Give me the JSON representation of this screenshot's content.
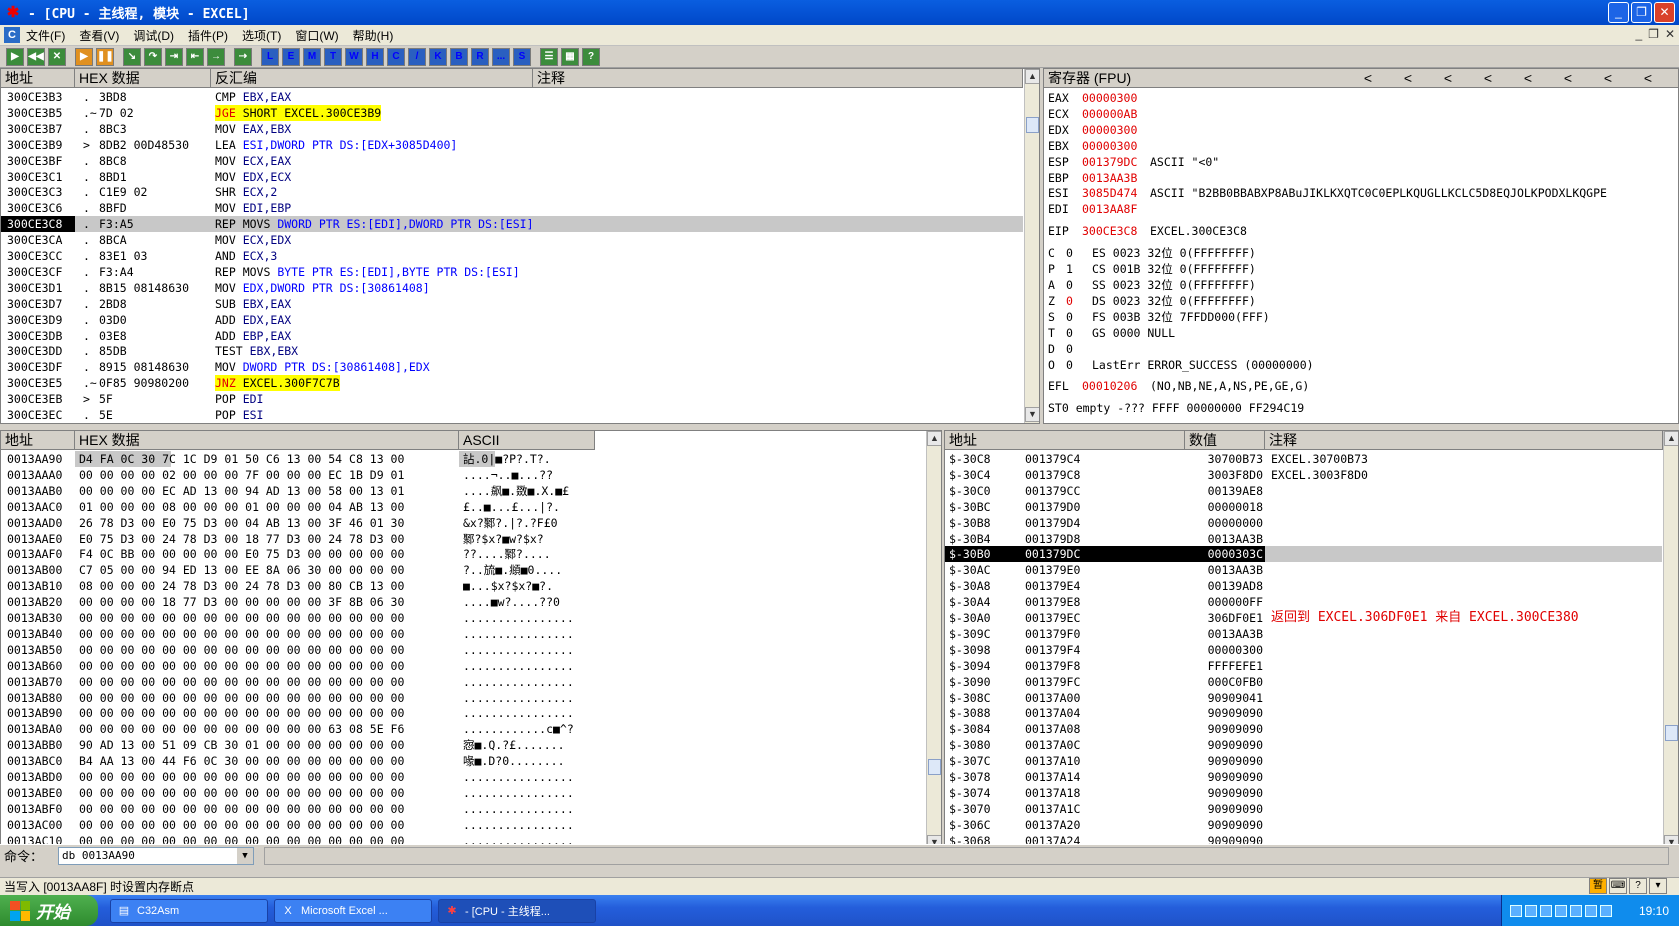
{
  "window": {
    "title": "- [CPU - 主线程, 模块 - EXCEL]",
    "icon": "ollydbg-bug-icon"
  },
  "menu": [
    "文件(F)",
    "查看(V)",
    "调试(D)",
    "插件(P)",
    "选项(T)",
    "窗口(W)",
    "帮助(H)"
  ],
  "mdi_buttons": [
    "_",
    "❐",
    "✕"
  ],
  "toolbar": {
    "nav": [
      "▶",
      "◀◀",
      "✕",
      "▶",
      "❚❚",
      "↘",
      "↷",
      "⇥",
      "⇤",
      "→",
      "⇢"
    ],
    "windows": [
      "L",
      "E",
      "M",
      "T",
      "W",
      "H",
      "C",
      "/",
      "K",
      "B",
      "R",
      "...",
      "S"
    ],
    "extra": [
      "☰",
      "▦",
      "?"
    ]
  },
  "disasm": {
    "headers": [
      "地址",
      "HEX 数据",
      "反汇编",
      "注释"
    ],
    "rows": [
      {
        "addr": "300CE3B3",
        "arrow": ".",
        "hex": "3BD8",
        "mnem": "CMP",
        "ops": " EBX,EAX"
      },
      {
        "addr": "300CE3B5",
        "arrow": ".~",
        "hex": "7D 02",
        "mnem": "JGE",
        "ops": " SHORT EXCEL.300CE3B9",
        "jmp": true
      },
      {
        "addr": "300CE3B7",
        "arrow": ".",
        "hex": "8BC3",
        "mnem": "MOV",
        "ops": " EAX,EBX"
      },
      {
        "addr": "300CE3B9",
        "arrow": ">",
        "hex": "8DB2 00D48530",
        "mnem": "LEA",
        "ops": " ESI,DWORD PTR DS:[EDX+3085D400]"
      },
      {
        "addr": "300CE3BF",
        "arrow": ".",
        "hex": "8BC8",
        "mnem": "MOV",
        "ops": " ECX,EAX"
      },
      {
        "addr": "300CE3C1",
        "arrow": ".",
        "hex": "8BD1",
        "mnem": "MOV",
        "ops": " EDX,ECX"
      },
      {
        "addr": "300CE3C3",
        "arrow": ".",
        "hex": "C1E9 02",
        "mnem": "SHR",
        "ops": " ECX,2"
      },
      {
        "addr": "300CE3C6",
        "arrow": ".",
        "hex": "8BFD",
        "mnem": "MOV",
        "ops": " EDI,EBP"
      },
      {
        "addr": "300CE3C8",
        "arrow": ".",
        "hex": "F3:A5",
        "mnem": "REP MOVS",
        "ops": " DWORD PTR ES:[EDI],DWORD PTR DS:[ESI]",
        "sel": true
      },
      {
        "addr": "300CE3CA",
        "arrow": ".",
        "hex": "8BCA",
        "mnem": "MOV",
        "ops": " ECX,EDX"
      },
      {
        "addr": "300CE3CC",
        "arrow": ".",
        "hex": "83E1 03",
        "mnem": "AND",
        "ops": " ECX,3"
      },
      {
        "addr": "300CE3CF",
        "arrow": ".",
        "hex": "F3:A4",
        "mnem": "REP MOVS",
        "ops": " BYTE PTR ES:[EDI],BYTE PTR DS:[ESI]"
      },
      {
        "addr": "300CE3D1",
        "arrow": ".",
        "hex": "8B15 08148630",
        "mnem": "MOV",
        "ops": " EDX,DWORD PTR DS:[30861408]"
      },
      {
        "addr": "300CE3D7",
        "arrow": ".",
        "hex": "2BD8",
        "mnem": "SUB",
        "ops": " EBX,EAX"
      },
      {
        "addr": "300CE3D9",
        "arrow": ".",
        "hex": "03D0",
        "mnem": "ADD",
        "ops": " EDX,EAX"
      },
      {
        "addr": "300CE3DB",
        "arrow": ".",
        "hex": "03E8",
        "mnem": "ADD",
        "ops": " EBP,EAX"
      },
      {
        "addr": "300CE3DD",
        "arrow": ".",
        "hex": "85DB",
        "mnem": "TEST",
        "ops": " EBX,EBX"
      },
      {
        "addr": "300CE3DF",
        "arrow": ".",
        "hex": "8915 08148630",
        "mnem": "MOV",
        "ops": " DWORD PTR DS:[30861408],EDX"
      },
      {
        "addr": "300CE3E5",
        "arrow": ".~",
        "hex": "0F85 90980200",
        "mnem": "JNZ",
        "ops": " EXCEL.300F7C7B",
        "jmp": true
      },
      {
        "addr": "300CE3EB",
        "arrow": ">",
        "hex": "5F",
        "mnem": "POP",
        "ops": " EDI"
      },
      {
        "addr": "300CE3EC",
        "arrow": ".",
        "hex": "5E",
        "mnem": "POP",
        "ops": " ESI"
      }
    ]
  },
  "registers": {
    "header": "寄存器 (FPU)",
    "arrows": [
      "<",
      "<",
      "<",
      "<",
      "<",
      "<",
      "<",
      "<"
    ],
    "gp": [
      {
        "name": "EAX",
        "value": "00000300",
        "comment": ""
      },
      {
        "name": "ECX",
        "value": "000000AB",
        "comment": ""
      },
      {
        "name": "EDX",
        "value": "00000300",
        "comment": ""
      },
      {
        "name": "EBX",
        "value": "00000300",
        "comment": ""
      },
      {
        "name": "ESP",
        "value": "001379DC",
        "comment": "ASCII \"<0\""
      },
      {
        "name": "EBP",
        "value": "0013AA3B",
        "comment": ""
      },
      {
        "name": "ESI",
        "value": "3085D474",
        "comment": "ASCII \"B2BB0BBABXP8ABuJIKLKXQTC0C0EPLKQUGLLKCLC5D8EQJOLKPODXLKQGPE"
      },
      {
        "name": "EDI",
        "value": "0013AA8F",
        "comment": ""
      }
    ],
    "eip": {
      "name": "EIP",
      "value": "300CE3C8",
      "comment": "EXCEL.300CE3C8"
    },
    "flags": [
      {
        "f": "C",
        "v": "0",
        "seg": "ES 0023 32位 0(FFFFFFFF)",
        "red": false
      },
      {
        "f": "P",
        "v": "1",
        "seg": "CS 001B 32位 0(FFFFFFFF)",
        "red": false
      },
      {
        "f": "A",
        "v": "0",
        "seg": "SS 0023 32位 0(FFFFFFFF)",
        "red": false
      },
      {
        "f": "Z",
        "v": "0",
        "seg": "DS 0023 32位 0(FFFFFFFF)",
        "red": true
      },
      {
        "f": "S",
        "v": "0",
        "seg": "FS 003B 32位 7FFDD000(FFF)",
        "red": false
      },
      {
        "f": "T",
        "v": "0",
        "seg": "GS 0000 NULL",
        "red": false
      },
      {
        "f": "D",
        "v": "0",
        "seg": "",
        "red": false
      },
      {
        "f": "O",
        "v": "0",
        "seg": "LastErr ERROR_SUCCESS (00000000)",
        "red": false
      }
    ],
    "efl": {
      "name": "EFL",
      "value": "00010206",
      "comment": "(NO,NB,NE,A,NS,PE,GE,G)"
    },
    "st0": "ST0 empty -??? FFFF 00000000 FF294C19"
  },
  "dump": {
    "headers": [
      "地址",
      "HEX 数据",
      "ASCII"
    ],
    "rows": [
      {
        "addr": "0013AA90",
        "hex": "D4 FA 0C 30 7C 1C D9 01 50 C6 13 00 54 C8 13 00",
        "ascii": "詀.0|■?P?.T?.",
        "sel": true
      },
      {
        "addr": "0013AAA0",
        "hex": "00 00 00 00 02 00 00 00 7F 00 00 00 EC 1B D9 01",
        "ascii": "....¬..■...??"
      },
      {
        "addr": "0013AAB0",
        "hex": "00 00 00 00 EC AD 13 00 94 AD 13 00 58 00 13 01",
        "ascii": "....飙■.敪■.X.■£"
      },
      {
        "addr": "0013AAC0",
        "hex": "01 00 00 00 08 00 00 00 01 00 00 00 04 AB 13 00",
        "ascii": "£..■...£...|?."
      },
      {
        "addr": "0013AAD0",
        "hex": "26 78 D3 00 E0 75 D3 00 04 AB 13 00 3F 46 01 30",
        "ascii": "&x?鄹?.|?.?F£0"
      },
      {
        "addr": "0013AAE0",
        "hex": "E0 75 D3 00 24 78 D3 00 18 77 D3 00 24 78 D3 00",
        "ascii": "鄹?$x?■w?$x?"
      },
      {
        "addr": "0013AAF0",
        "hex": "F4 0C BB 00 00 00 00 00 E0 75 D3 00 00 00 00 00",
        "ascii": "??....鄹?...."
      },
      {
        "addr": "0013AB00",
        "hex": "C7 05 00 00 94 ED 13 00 EE 8A 06 30 00 00 00 00",
        "ascii": "?..旈■.頫■0...."
      },
      {
        "addr": "0013AB10",
        "hex": "08 00 00 00 24 78 D3 00 24 78 D3 00 80 CB 13 00",
        "ascii": "■...$x?$x?■?."
      },
      {
        "addr": "0013AB20",
        "hex": "00 00 00 00 18 77 D3 00 00 00 00 00 3F 8B 06 30",
        "ascii": "....■w?....??0"
      },
      {
        "addr": "0013AB30",
        "hex": "00 00 00 00 00 00 00 00 00 00 00 00 00 00 00 00",
        "ascii": "................"
      },
      {
        "addr": "0013AB40",
        "hex": "00 00 00 00 00 00 00 00 00 00 00 00 00 00 00 00",
        "ascii": "................"
      },
      {
        "addr": "0013AB50",
        "hex": "00 00 00 00 00 00 00 00 00 00 00 00 00 00 00 00",
        "ascii": "................"
      },
      {
        "addr": "0013AB60",
        "hex": "00 00 00 00 00 00 00 00 00 00 00 00 00 00 00 00",
        "ascii": "................"
      },
      {
        "addr": "0013AB70",
        "hex": "00 00 00 00 00 00 00 00 00 00 00 00 00 00 00 00",
        "ascii": "................"
      },
      {
        "addr": "0013AB80",
        "hex": "00 00 00 00 00 00 00 00 00 00 00 00 00 00 00 00",
        "ascii": "................"
      },
      {
        "addr": "0013AB90",
        "hex": "00 00 00 00 00 00 00 00 00 00 00 00 00 00 00 00",
        "ascii": "................"
      },
      {
        "addr": "0013ABA0",
        "hex": "00 00 00 00 00 00 00 00 00 00 00 00 63 08 5E F6",
        "ascii": "............c■^?"
      },
      {
        "addr": "0013ABB0",
        "hex": "90 AD 13 00 51 09 CB 30 01 00 00 00 00 00 00 00",
        "ascii": "惌■.Q.?£......."
      },
      {
        "addr": "0013ABC0",
        "hex": "B4 AA 13 00 44 F6 0C 30 00 00 00 00 00 00 00 00",
        "ascii": "喙■.D?0........"
      },
      {
        "addr": "0013ABD0",
        "hex": "00 00 00 00 00 00 00 00 00 00 00 00 00 00 00 00",
        "ascii": "................"
      },
      {
        "addr": "0013ABE0",
        "hex": "00 00 00 00 00 00 00 00 00 00 00 00 00 00 00 00",
        "ascii": "................"
      },
      {
        "addr": "0013ABF0",
        "hex": "00 00 00 00 00 00 00 00 00 00 00 00 00 00 00 00",
        "ascii": "................"
      },
      {
        "addr": "0013AC00",
        "hex": "00 00 00 00 00 00 00 00 00 00 00 00 00 00 00 00",
        "ascii": "................"
      },
      {
        "addr": "0013AC10",
        "hex": "00 00 00 00 00 00 00 00 00 00 00 00 00 00 00 00",
        "ascii": "................"
      }
    ]
  },
  "stack": {
    "headers": [
      "地址",
      "数值",
      "注释"
    ],
    "rows": [
      {
        "off": "$-30C8",
        "addr": "001379C4",
        "val": "30700B73",
        "comment": "EXCEL.30700B73"
      },
      {
        "off": "$-30C4",
        "addr": "001379C8",
        "val": "3003F8D0",
        "comment": "EXCEL.3003F8D0"
      },
      {
        "off": "$-30C0",
        "addr": "001379CC",
        "val": "00139AE8",
        "comment": ""
      },
      {
        "off": "$-30BC",
        "addr": "001379D0",
        "val": "00000018",
        "comment": ""
      },
      {
        "off": "$-30B8",
        "addr": "001379D4",
        "val": "00000000",
        "comment": ""
      },
      {
        "off": "$-30B4",
        "addr": "001379D8",
        "val": "0013AA3B",
        "comment": ""
      },
      {
        "off": "$-30B0",
        "addr": "001379DC",
        "val": "0000303C",
        "comment": "",
        "sel": true
      },
      {
        "off": "$-30AC",
        "addr": "001379E0",
        "val": "0013AA3B",
        "comment": ""
      },
      {
        "off": "$-30A8",
        "addr": "001379E4",
        "val": "00139AD8",
        "comment": ""
      },
      {
        "off": "$-30A4",
        "addr": "001379E8",
        "val": "000000FF",
        "comment": ""
      },
      {
        "off": "$-30A0",
        "addr": "001379EC",
        "val": "306DF0E1",
        "comment": "返回到 EXCEL.306DF0E1 来自 EXCEL.300CE380",
        "red": true
      },
      {
        "off": "$-309C",
        "addr": "001379F0",
        "val": "0013AA3B",
        "comment": ""
      },
      {
        "off": "$-3098",
        "addr": "001379F4",
        "val": "00000300",
        "comment": ""
      },
      {
        "off": "$-3094",
        "addr": "001379F8",
        "val": "FFFFEFE1",
        "comment": ""
      },
      {
        "off": "$-3090",
        "addr": "001379FC",
        "val": "000C0FB0",
        "comment": ""
      },
      {
        "off": "$-308C",
        "addr": "00137A00",
        "val": "90909041",
        "comment": ""
      },
      {
        "off": "$-3088",
        "addr": "00137A04",
        "val": "90909090",
        "comment": ""
      },
      {
        "off": "$-3084",
        "addr": "00137A08",
        "val": "90909090",
        "comment": ""
      },
      {
        "off": "$-3080",
        "addr": "00137A0C",
        "val": "90909090",
        "comment": ""
      },
      {
        "off": "$-307C",
        "addr": "00137A10",
        "val": "90909090",
        "comment": ""
      },
      {
        "off": "$-3078",
        "addr": "00137A14",
        "val": "90909090",
        "comment": ""
      },
      {
        "off": "$-3074",
        "addr": "00137A18",
        "val": "90909090",
        "comment": ""
      },
      {
        "off": "$-3070",
        "addr": "00137A1C",
        "val": "90909090",
        "comment": ""
      },
      {
        "off": "$-306C",
        "addr": "00137A20",
        "val": "90909090",
        "comment": ""
      },
      {
        "off": "$-3068",
        "addr": "00137A24",
        "val": "90909090",
        "comment": ""
      }
    ]
  },
  "command": {
    "label": "命令：",
    "value": "db 0013AA90"
  },
  "status": {
    "text": "当写入 [0013AA8F] 时设置内存断点"
  },
  "taskbar": {
    "start": "开始",
    "tasks": [
      {
        "label": "C32Asm",
        "icon": "folder-icon"
      },
      {
        "label": "Microsoft Excel ...",
        "icon": "excel-icon"
      },
      {
        "label": "- [CPU - 主线程...",
        "icon": "ollydbg-bug-icon",
        "active": true
      }
    ],
    "clock": "19:10"
  },
  "ime": [
    "暂",
    "⌨",
    "?",
    "▾"
  ]
}
